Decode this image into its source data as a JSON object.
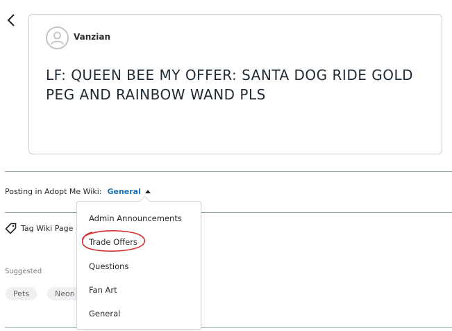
{
  "post": {
    "author": "Vanzian",
    "title": "LF: QUEEN BEE MY OFFER: SANTA DOG RIDE GOLD PEG AND RAINBOW WAND PLS"
  },
  "posting": {
    "label": "Posting in Adopt Me Wiki:",
    "category": "General"
  },
  "tag": {
    "label": "Tag Wiki Page"
  },
  "suggested": {
    "label": "Suggested",
    "chips": [
      "Pets",
      "Neon"
    ]
  },
  "dropdown": {
    "options": [
      "Admin Announcements",
      "Trade Offers",
      "Questions",
      "Fan Art",
      "General"
    ],
    "highlighted": "Trade Offers",
    "highlight_color": "#d62a2a"
  },
  "colors": {
    "accent": "#1a73b8",
    "divider": "#8fa39d"
  }
}
